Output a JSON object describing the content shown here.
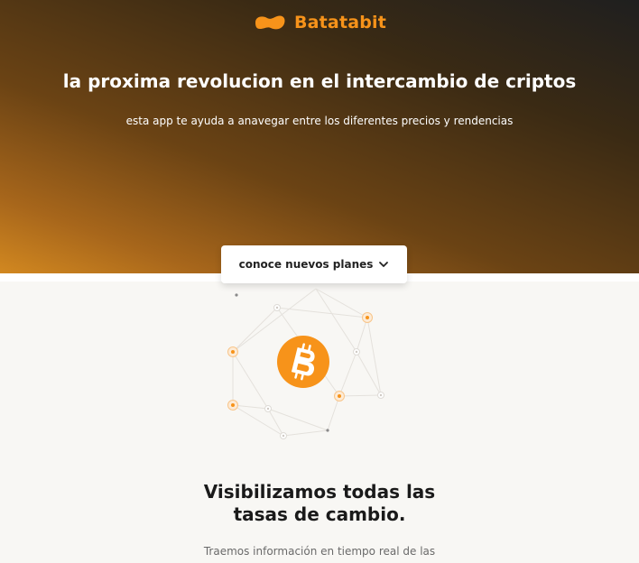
{
  "brand": {
    "name": "Batatabit",
    "logo_icon": "potato-logo-icon",
    "accent": "#f7931a"
  },
  "hero": {
    "title": "la proxima revolucion en el intercambio de criptos",
    "subtitle": "esta app te ayuda a anavegar entre los diferentes precios y rendencias"
  },
  "cta": {
    "label": "conoce nuevos planes",
    "icon": "chevron-down-icon"
  },
  "illustration": {
    "center_icon": "bitcoin-icon",
    "center_color": "#f7931a"
  },
  "section": {
    "title_line1": "Visibilizamos todas las",
    "title_line2": "tasas de cambio.",
    "text": "Traemos información en tiempo real de las"
  }
}
